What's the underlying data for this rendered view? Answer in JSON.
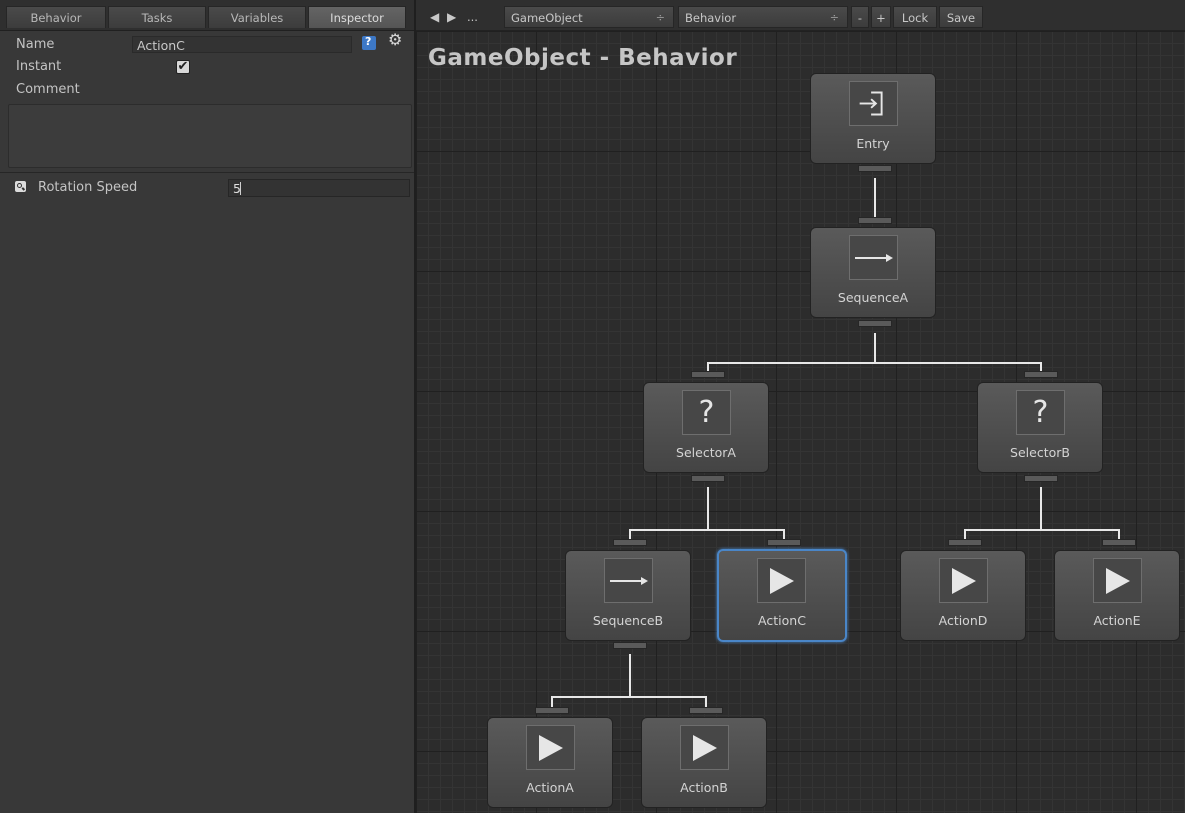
{
  "tabs": [
    "Behavior",
    "Tasks",
    "Variables",
    "Inspector"
  ],
  "inspector": {
    "name_label": "Name",
    "name_value": "ActionC",
    "instant_label": "Instant",
    "instant_checked": "✔",
    "comment_label": "Comment",
    "rotation_speed_label": "Rotation Speed",
    "rotation_speed_value": "5"
  },
  "toolbar": {
    "back": "◀",
    "forward": "▶",
    "more": "...",
    "gameobject": "GameObject",
    "behavior": "Behavior",
    "minus": "-",
    "plus": "+",
    "lock": "Lock",
    "save": "Save",
    "dropdown_arrow": "÷"
  },
  "graph": {
    "title": "GameObject - Behavior",
    "nodes": {
      "entry": "Entry",
      "sequence_a": "SequenceA",
      "selector_a": "SelectorA",
      "selector_b": "SelectorB",
      "sequence_b": "SequenceB",
      "action_c": "ActionC",
      "action_d": "ActionD",
      "action_e": "ActionE",
      "action_a": "ActionA",
      "action_b": "ActionB"
    },
    "selected_node": "ActionC",
    "selection_color": "#4a86c8"
  }
}
